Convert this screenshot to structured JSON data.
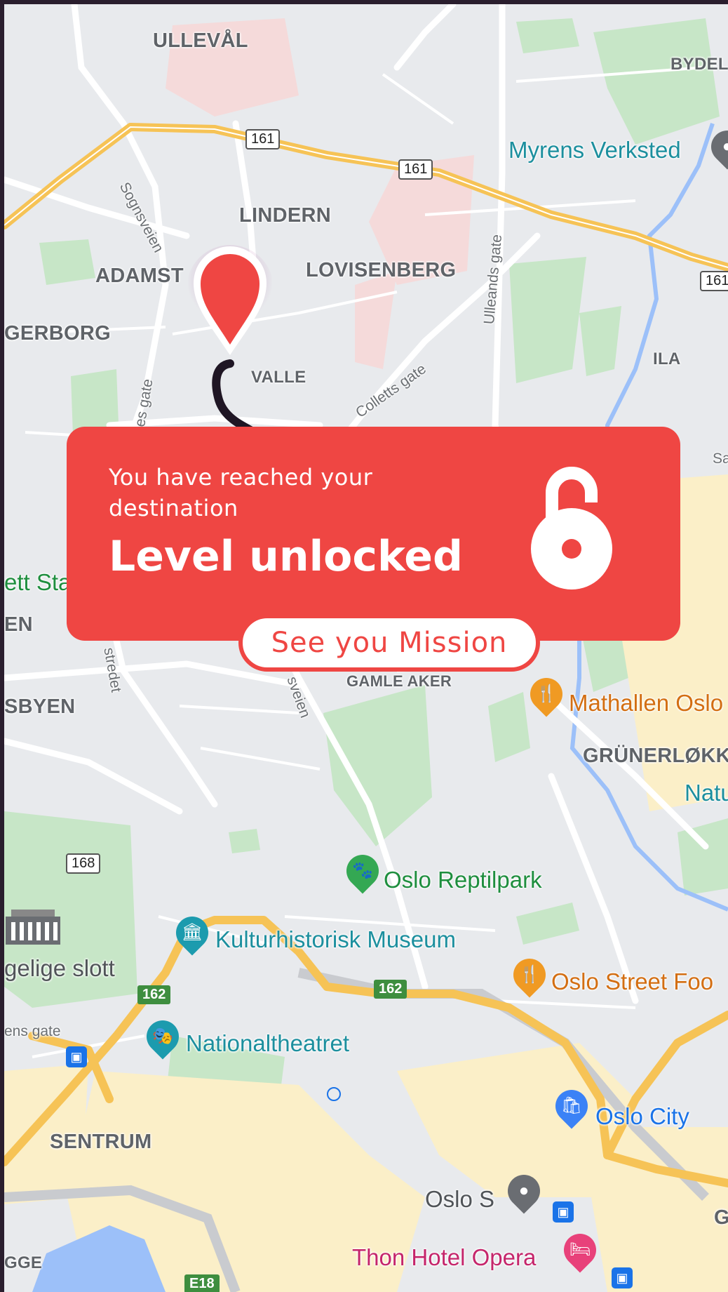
{
  "map": {
    "districts": [
      "ULLEVÅL",
      "LINDERN",
      "ADAMST",
      "LOVISENBERG",
      "GERBORG",
      "VALLE",
      "ILA",
      "EN",
      "SBYEN",
      "GRÜNERLØKK",
      "SENTRUM",
      "BYDEL",
      "GAMLE AKER",
      "GGE",
      "G"
    ],
    "streets": [
      "Sognsveien",
      "Ulleands gate",
      "Colletts gate",
      "es gate",
      "stredet",
      "sveien",
      "ens gate",
      "Sa"
    ],
    "road_shields": [
      "161",
      "161",
      "161",
      "168",
      "162",
      "162",
      "E18"
    ],
    "pois": [
      {
        "name": "Myrens Verksted",
        "icon": "map-pin-icon"
      },
      {
        "name": "Mathallen Oslo",
        "icon": "restaurant-icon"
      },
      {
        "name": "Natu",
        "icon": ""
      },
      {
        "name": "Oslo Reptilpark",
        "icon": "paw-icon"
      },
      {
        "name": "Kulturhistorisk Museum",
        "icon": "museum-icon"
      },
      {
        "name": "Oslo Street Foo",
        "icon": "restaurant-icon"
      },
      {
        "name": "Nationaltheatret",
        "icon": "theater-icon"
      },
      {
        "name": "Oslo City",
        "icon": "shopping-bag-icon"
      },
      {
        "name": "Oslo S",
        "icon": "map-pin-icon"
      },
      {
        "name": "Thon Hotel Opera",
        "icon": "hotel-icon"
      },
      {
        "name": "gelige slott",
        "icon": "palace-icon"
      },
      {
        "name": "ett Sta",
        "icon": ""
      }
    ]
  },
  "card": {
    "subtitle": "You have reached your destination",
    "title": "Level unlocked",
    "status_icon": "unlocked-padlock-icon",
    "button_label": "See you Mission"
  },
  "colors": {
    "accent": "#ef4643",
    "route": "#1f1624"
  }
}
